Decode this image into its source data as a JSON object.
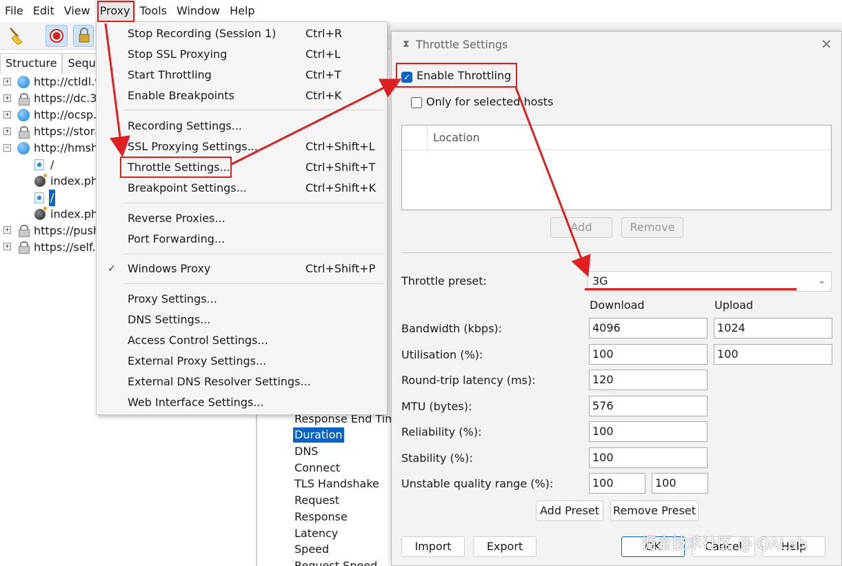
{
  "menubar": {
    "items": [
      "File",
      "Edit",
      "View",
      "Proxy",
      "Tools",
      "Window",
      "Help"
    ]
  },
  "left_panel": {
    "tabs": [
      "Structure",
      "Seque"
    ],
    "tree": [
      "http://ctldl.w",
      "https://dc.3",
      "http://ocsp.",
      "https://stora",
      "http://hmsh",
      "/",
      "index.ph",
      "/",
      "index.ph",
      "https://push",
      "https://self."
    ]
  },
  "detail_list": {
    "items": [
      "Response End Time",
      "Duration",
      "DNS",
      "Connect",
      "TLS Handshake",
      "Request",
      "Response",
      "Latency",
      "Speed",
      "Request Speed"
    ],
    "selected": "Duration"
  },
  "proxy_menu": {
    "items": [
      {
        "label": "Stop Recording (Session 1)",
        "shortcut": "Ctrl+R"
      },
      {
        "label": "Stop SSL Proxying",
        "shortcut": "Ctrl+L"
      },
      {
        "label": "Start Throttling",
        "shortcut": "Ctrl+T"
      },
      {
        "label": "Enable Breakpoints",
        "shortcut": "Ctrl+K"
      },
      {
        "label": "Recording Settings...",
        "shortcut": ""
      },
      {
        "label": "SSL Proxying Settings...",
        "shortcut": "Ctrl+Shift+L"
      },
      {
        "label": "Throttle Settings...",
        "shortcut": "Ctrl+Shift+T"
      },
      {
        "label": "Breakpoint Settings...",
        "shortcut": "Ctrl+Shift+K"
      },
      {
        "label": "Reverse Proxies...",
        "shortcut": ""
      },
      {
        "label": "Port Forwarding...",
        "shortcut": ""
      },
      {
        "label": "Windows Proxy",
        "shortcut": "Ctrl+Shift+P",
        "checked": true
      },
      {
        "label": "Proxy Settings...",
        "shortcut": ""
      },
      {
        "label": "DNS Settings...",
        "shortcut": ""
      },
      {
        "label": "Access Control Settings...",
        "shortcut": ""
      },
      {
        "label": "External Proxy Settings...",
        "shortcut": ""
      },
      {
        "label": "External DNS Resolver Settings...",
        "shortcut": ""
      },
      {
        "label": "Web Interface Settings...",
        "shortcut": ""
      }
    ]
  },
  "dialog": {
    "title": "Throttle Settings",
    "enable_throttling": "Enable Throttling",
    "only_selected_hosts": "Only for selected hosts",
    "location_header": "Location",
    "add_label": "Add",
    "remove_label": "Remove",
    "preset_label": "Throttle preset:",
    "preset_value": "3G",
    "download_header": "Download",
    "upload_header": "Upload",
    "bandwidth_label": "Bandwidth (kbps):",
    "bandwidth_download": "4096",
    "bandwidth_upload": "1024",
    "utilisation_label": "Utilisation (%):",
    "utilisation_download": "100",
    "utilisation_upload": "100",
    "latency_label": "Round-trip latency (ms):",
    "latency_value": "120",
    "mtu_label": "MTU (bytes):",
    "mtu_value": "576",
    "reliability_label": "Reliability (%):",
    "reliability_value": "100",
    "stability_label": "Stability (%):",
    "stability_value": "100",
    "unstable_label": "Unstable quality range (%):",
    "unstable_min": "100",
    "unstable_max": "100",
    "add_preset": "Add Preset",
    "remove_preset": "Remove Preset",
    "import_label": "Import",
    "export_label": "Export",
    "ok_label": "OK",
    "cancel_label": "Cancel",
    "help_label": "Help"
  },
  "watermark": "掘金技术社区 @ QALab",
  "colors": {
    "highlight": "#e02020",
    "selection": "#0a64c8"
  }
}
